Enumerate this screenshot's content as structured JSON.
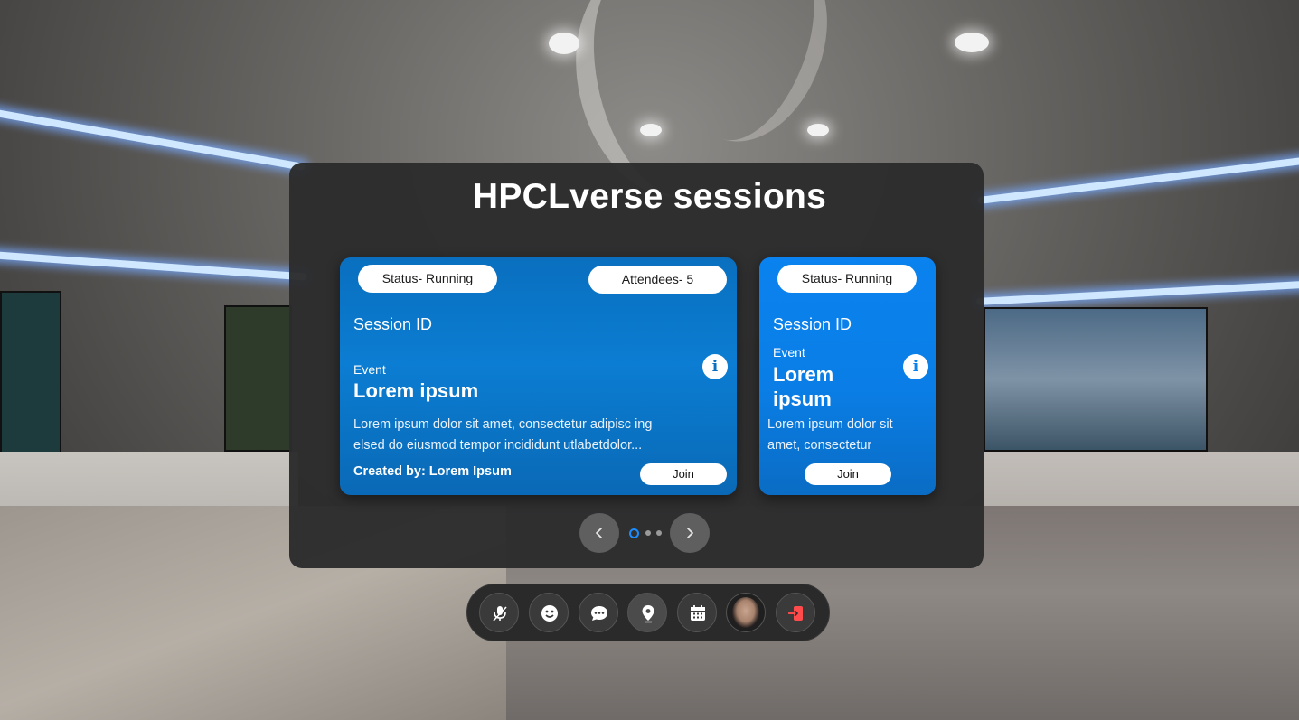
{
  "panel": {
    "title": "HPCLverse sessions"
  },
  "cards": [
    {
      "status": "Status- Running",
      "attendees": "Attendees- 5",
      "session_id_label": "Session ID",
      "event_label": "Event",
      "event_name": "Lorem ipsum",
      "description_line1": "Lorem ipsum dolor sit amet, consectetur adipisc ing",
      "description_line2": "elsed do eiusmod tempor incididunt utlabetdolor...",
      "created_by": "Created by: Lorem Ipsum",
      "join_label": "Join",
      "info_icon": "i"
    },
    {
      "status": "Status- Running",
      "session_id_label": "Session ID",
      "event_label": "Event",
      "event_name_line1": "Lorem",
      "event_name_line2": "ipsum",
      "description_line1": "Lorem ipsum dolor sit",
      "description_line2": "amet, consectetur",
      "join_label": "Join",
      "info_icon": "i"
    }
  ],
  "pagination": {
    "pages": 3,
    "active_page": 1
  },
  "toolbar": {
    "items": [
      "mic-icon",
      "emoji-icon",
      "chat-icon",
      "location-pin-icon",
      "calendar-icon",
      "avatar",
      "exit-icon"
    ]
  },
  "colors": {
    "card_blue": "#0a6fbf",
    "card_blue_light": "#0a82ef",
    "active_dot": "#1c8cff",
    "exit_red": "#ff4b4b"
  }
}
